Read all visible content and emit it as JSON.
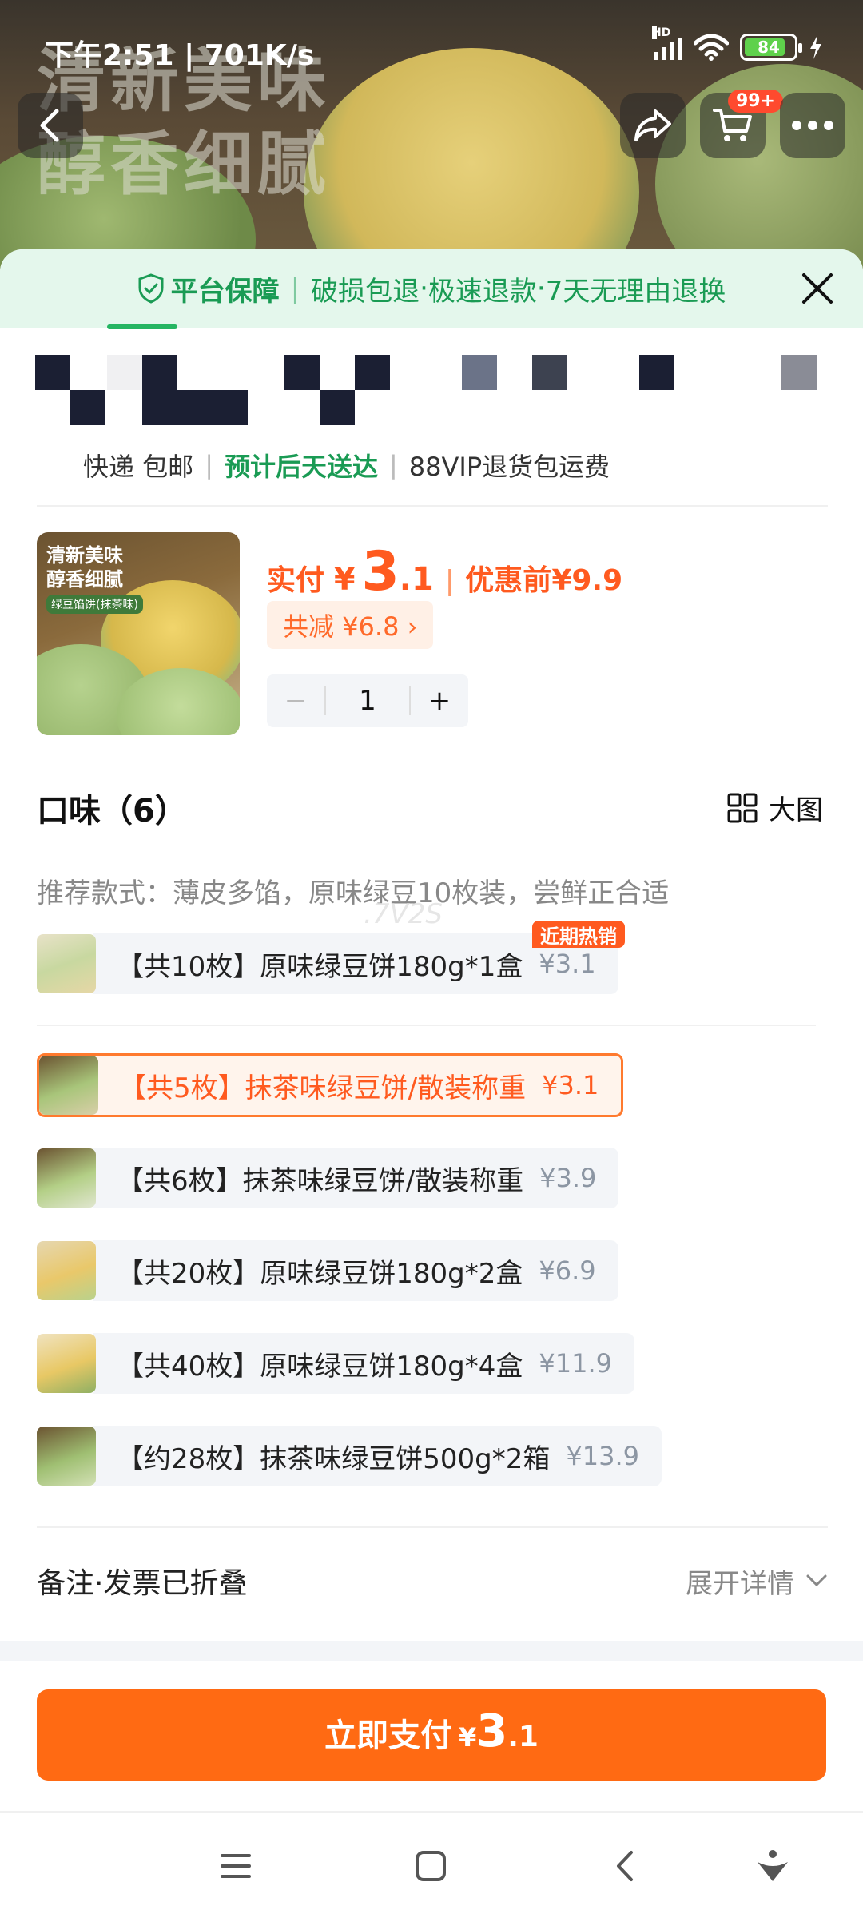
{
  "status_bar": {
    "time_speed": "下午2:51 | 701K/s",
    "network_tag": "HD",
    "battery_level": "84",
    "battery_fraction": 0.84
  },
  "header": {
    "slogan_line1": "清新美味",
    "slogan_line2": "醇香细腻",
    "cart_badge": "99+"
  },
  "guarantee": {
    "title": "平台保障",
    "items": [
      "破损包退",
      "极速退款",
      "7天无理由退换"
    ],
    "separator": "·"
  },
  "shipping": {
    "method": "快递 包邮",
    "tag_partial": "预计后天送达",
    "vip": "88VIP退货包运费"
  },
  "product": {
    "thumb_title_line1": "清新美味",
    "thumb_title_line2": "醇香细腻",
    "thumb_tag": "绿豆馅饼(抹茶味)",
    "pay_label": "实付",
    "currency": "¥",
    "price_int": "3",
    "price_dec": ".1",
    "before_label": "优惠前",
    "before_price": "¥9.9",
    "discount_text": "共减 ¥6.8 ›",
    "quantity": "1",
    "minus": "−",
    "plus": "+"
  },
  "flavor": {
    "title": "口味（6）",
    "view_label": "大图",
    "hint": "推荐款式：薄皮多馅，原味绿豆10枚装，尝鲜正合适",
    "watermark": ".7V2S",
    "hot_badge": "近期热销",
    "options": [
      {
        "label": "【共10枚】原味绿豆饼180g*1盒",
        "price": "¥3.1"
      },
      {
        "label": "【共5枚】抹茶味绿豆饼/散装称重",
        "price": "¥3.1"
      },
      {
        "label": "【共6枚】抹茶味绿豆饼/散装称重",
        "price": "¥3.9"
      },
      {
        "label": "【共20枚】原味绿豆饼180g*2盒",
        "price": "¥6.9"
      },
      {
        "label": "【共40枚】原味绿豆饼180g*4盒",
        "price": "¥11.9"
      },
      {
        "label": "【约28枚】抹茶味绿豆饼500g*2箱",
        "price": "¥13.9"
      }
    ]
  },
  "remark": {
    "left": "备注·发票已折叠",
    "right": "展开详情"
  },
  "pay": {
    "label": "立即支付",
    "currency": "¥",
    "price_int": "3",
    "price_dec": ".1"
  },
  "colors": {
    "accent": "#ff6a13",
    "price": "#ff5a1f",
    "guarantee_green": "#1a9b54",
    "option_bg": "#f3f5f8"
  },
  "icons": [
    "back-icon",
    "share-icon",
    "cart-icon",
    "more-icon",
    "shield-check-icon",
    "close-icon",
    "grid-icon",
    "chevron-down-icon",
    "menu-icon",
    "home-icon",
    "nav-back-icon",
    "accessibility-icon"
  ]
}
